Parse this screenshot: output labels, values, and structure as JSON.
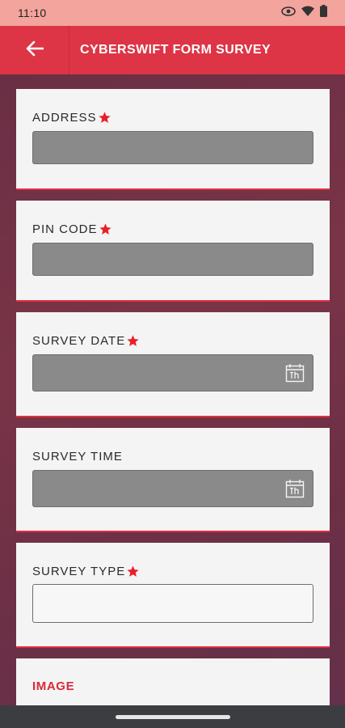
{
  "status_bar": {
    "time": "11:10"
  },
  "app_bar": {
    "title": "CYBERSWIFT FORM SURVEY"
  },
  "form": {
    "address": {
      "label": "ADDRESS",
      "value": ""
    },
    "pin_code": {
      "label": "PIN CODE",
      "value": ""
    },
    "survey_date": {
      "label": "SURVEY DATE",
      "value": ""
    },
    "survey_time": {
      "label": "SURVEY TIME",
      "value": ""
    },
    "survey_type": {
      "label": "SURVEY TYPE",
      "value": ""
    },
    "image": {
      "label": "IMAGE"
    }
  },
  "colors": {
    "app_bar": "#dd3546",
    "status_bar": "#f2a49d",
    "background": "#6e3447",
    "required_star": "#e8202a",
    "disabled_input": "#8a8a8a"
  },
  "icons": {
    "back": "arrow-left",
    "calendar": "calendar-icon",
    "required": "star"
  }
}
